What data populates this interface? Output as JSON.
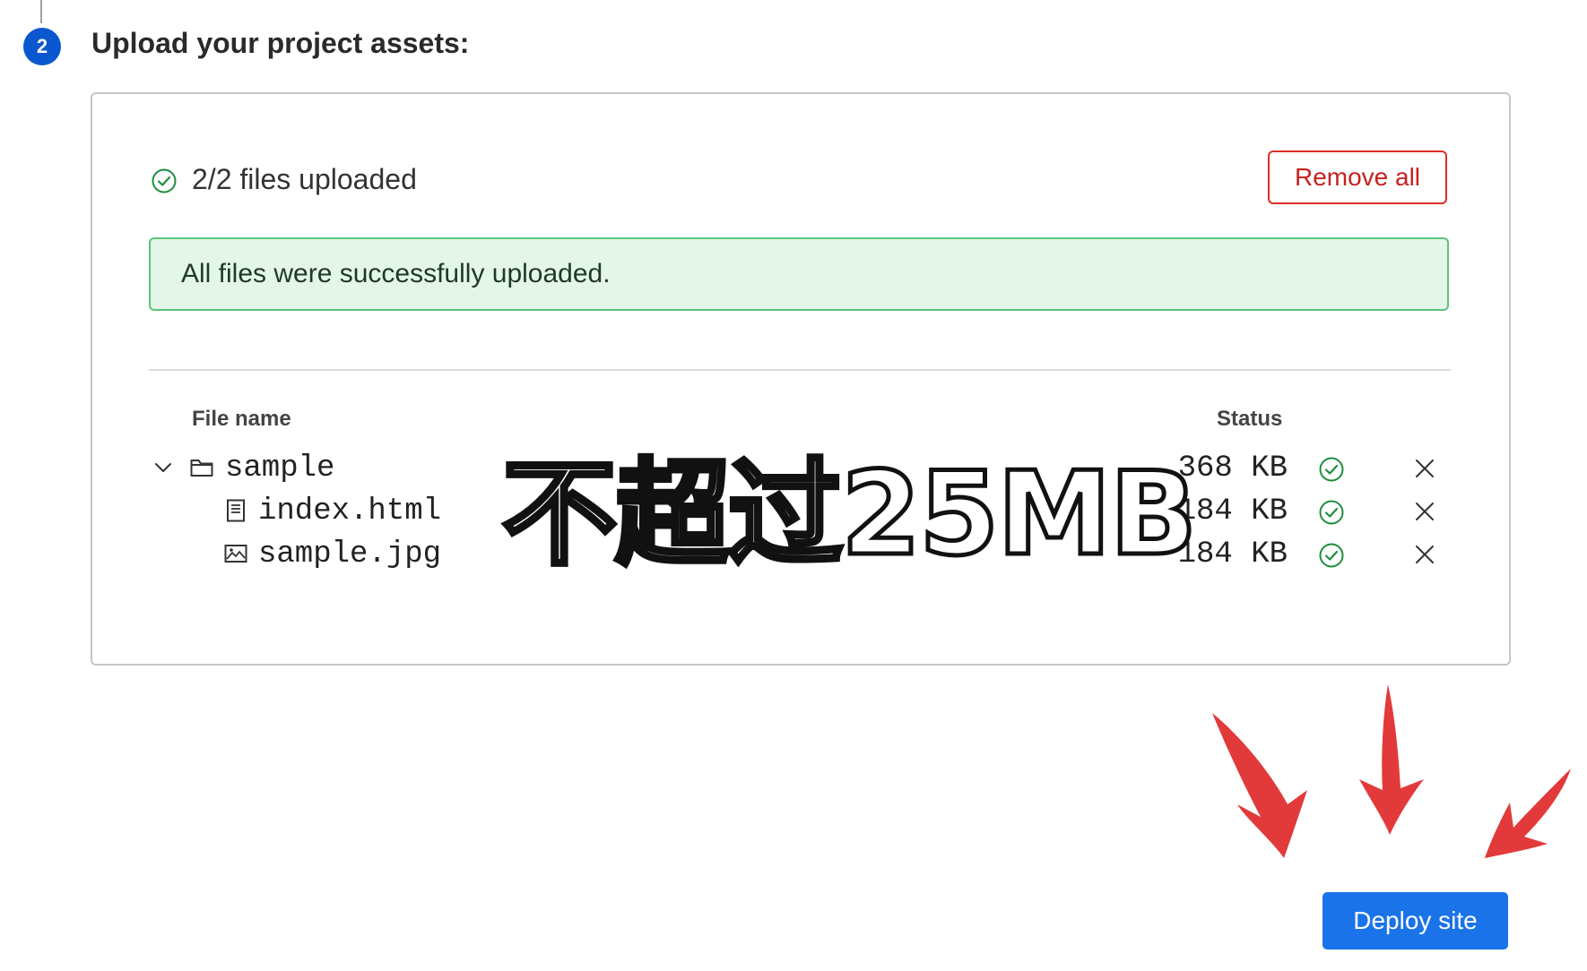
{
  "step": {
    "number": "2",
    "title": "Upload your project assets:"
  },
  "upload": {
    "summary": "2/2 files uploaded",
    "remove_all_label": "Remove all",
    "success_message": "All files were successfully uploaded."
  },
  "table": {
    "col_file": "File name",
    "col_status": "Status",
    "rows": [
      {
        "name": "sample",
        "size": "368 KB",
        "type": "folder-icon",
        "expanded": true
      },
      {
        "name": "index.html",
        "size": "184 KB",
        "type": "document-icon"
      },
      {
        "name": "sample.jpg",
        "size": "184 KB",
        "type": "image-icon"
      }
    ]
  },
  "overlay_caption": "不超过25MB",
  "deploy_label": "Deploy site",
  "colors": {
    "primary": "#1a73e8",
    "danger": "#d93025",
    "success": "#34a853",
    "success_bg": "#e3f6e8"
  }
}
